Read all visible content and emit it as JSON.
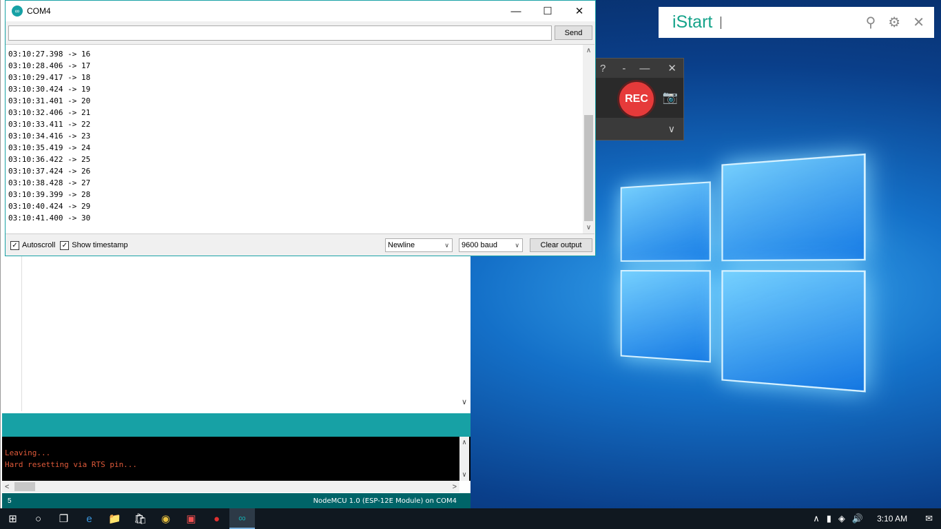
{
  "serial_monitor": {
    "title": "COM4",
    "input_value": "",
    "send_label": "Send",
    "lines": [
      "03:10:27.398 -> 16",
      "03:10:28.406 -> 17",
      "03:10:29.417 -> 18",
      "03:10:30.424 -> 19",
      "03:10:31.401 -> 20",
      "03:10:32.406 -> 21",
      "03:10:33.411 -> 22",
      "03:10:34.416 -> 23",
      "03:10:35.419 -> 24",
      "03:10:36.422 -> 25",
      "03:10:37.424 -> 26",
      "03:10:38.428 -> 27",
      "03:10:39.399 -> 28",
      "03:10:40.424 -> 29",
      "03:10:41.400 -> 30"
    ],
    "autoscroll_label": "Autoscroll",
    "autoscroll_checked": true,
    "timestamp_label": "Show timestamp",
    "timestamp_checked": true,
    "line_ending": "Newline",
    "baud": "9600 baud",
    "clear_label": "Clear output"
  },
  "ide": {
    "console_lines": [
      "Leaving...",
      "Hard resetting via RTS pin..."
    ],
    "status_line": "5",
    "board": "NodeMCU 1.0 (ESP-12E Module) on COM4"
  },
  "istart": {
    "logo": "iStart"
  },
  "recorder": {
    "rec_label": "REC",
    "help": "?"
  },
  "taskbar": {
    "clock": "3:10 AM"
  }
}
